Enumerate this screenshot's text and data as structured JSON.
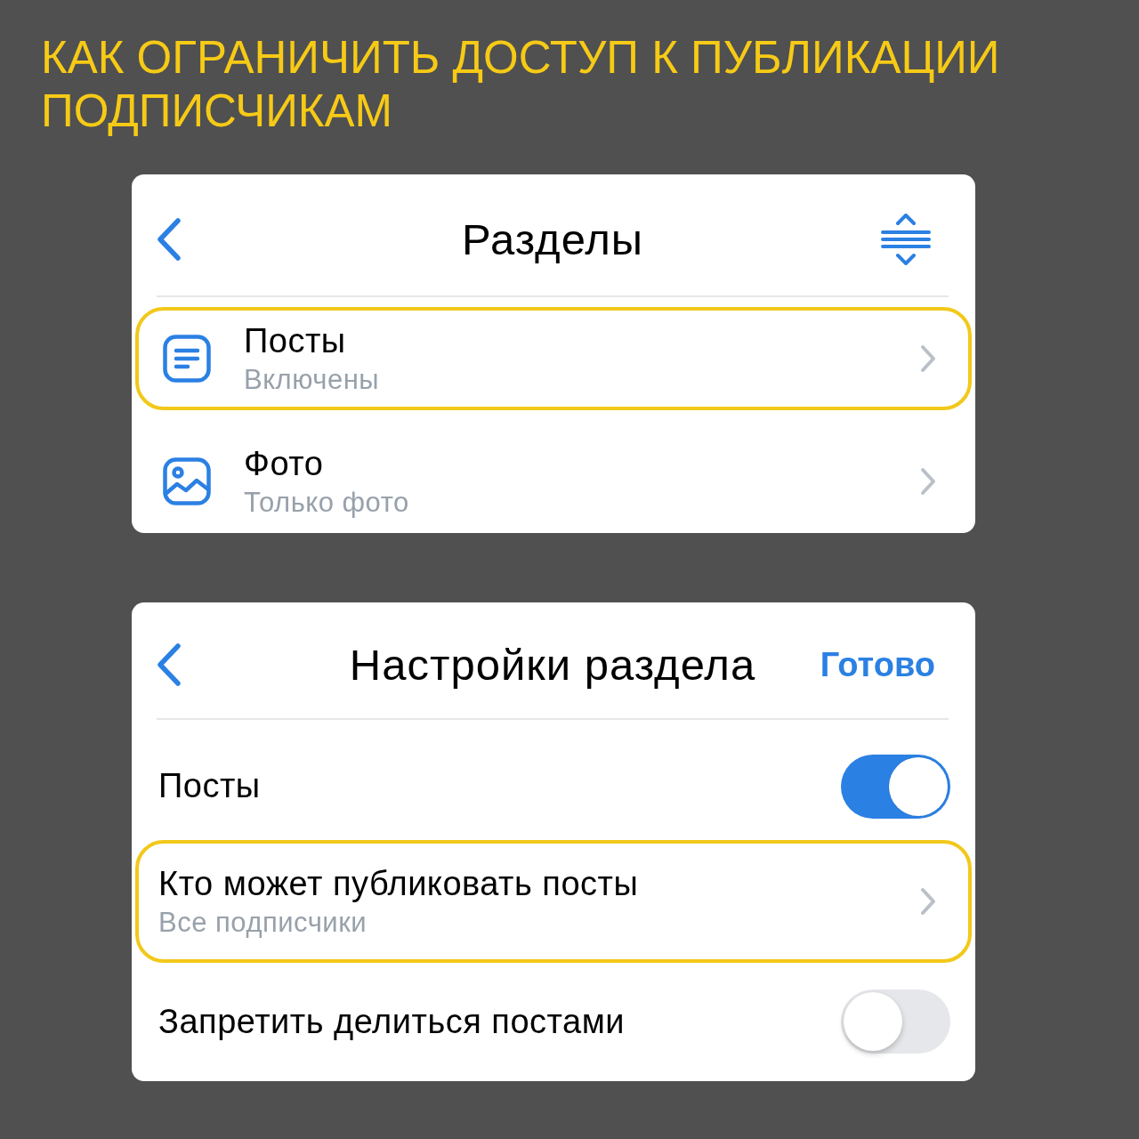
{
  "title": "КАК ОГРАНИЧИТЬ ДОСТУП К ПУБЛИКАЦИИ ПОДПИСЧИКАМ",
  "sections_screen": {
    "title": "Разделы",
    "rows": [
      {
        "title": "Посты",
        "subtitle": "Включены",
        "highlighted": true
      },
      {
        "title": "Фото",
        "subtitle": "Только фото",
        "highlighted": false
      }
    ]
  },
  "section_settings_screen": {
    "title": "Настройки раздела",
    "done_button": "Готово",
    "rows": [
      {
        "kind": "toggle",
        "label": "Посты",
        "on": true
      },
      {
        "kind": "link",
        "label": "Кто может публиковать посты",
        "subtitle": "Все подписчики",
        "highlighted": true
      },
      {
        "kind": "toggle",
        "label": "Запретить делиться постами",
        "on": false
      }
    ]
  }
}
